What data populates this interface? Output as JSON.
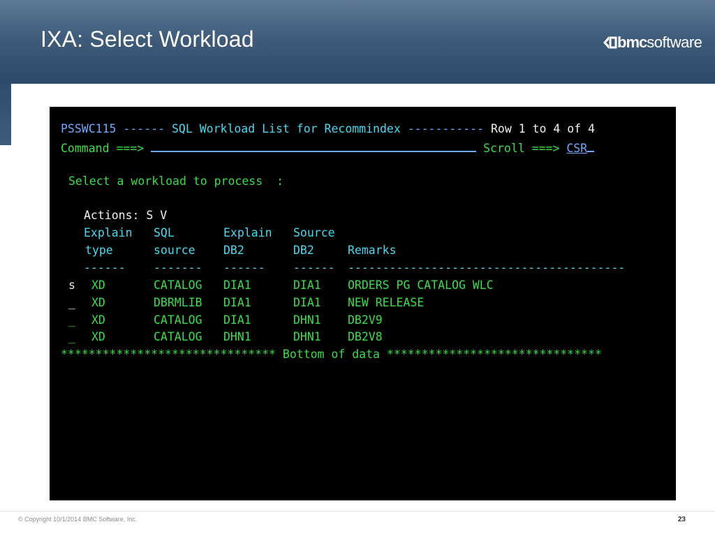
{
  "slide": {
    "title": "IXA: Select Workload",
    "logo_bold": "bmc",
    "logo_light": "software",
    "copyright": "© Copyright 10/1/2014 BMC Software, Inc.",
    "page_number": "23"
  },
  "terminal": {
    "panel_id": "PSSWC115",
    "title_dashes_left": "------",
    "title": "SQL Workload List for Recommindex",
    "title_dashes_right": "-----------",
    "row_info": "Row 1 to 4 of 4",
    "command_label": "Command ===>",
    "command_value": "",
    "scroll_label": "Scroll ===>",
    "scroll_value": "CSR",
    "prompt": "Select a workload to process  :",
    "actions_label": "Actions:",
    "actions_values": "S V",
    "columns": {
      "explain_type_1": "Explain",
      "explain_type_2": "type",
      "sql_source_1": "SQL",
      "sql_source_2": "source",
      "explain_db2_1": "Explain",
      "explain_db2_2": "DB2",
      "source_db2_1": "Source",
      "source_db2_2": "DB2",
      "remarks": "Remarks"
    },
    "separators": {
      "c1": "------",
      "c2": "-------",
      "c3": "------",
      "c4": "------",
      "c5": "----------------------------------------"
    },
    "rows": [
      {
        "sel": "s",
        "type": "XD",
        "source": "CATALOG",
        "explain_db2": "DIA1",
        "source_db2": "DIA1",
        "remarks": "ORDERS PG CATALOG WLC"
      },
      {
        "sel": "_",
        "type": "XD",
        "source": "DBRMLIB",
        "explain_db2": "DIA1",
        "source_db2": "DIA1",
        "remarks": "NEW RELEASE"
      },
      {
        "sel": "_",
        "type": "XD",
        "source": "CATALOG",
        "explain_db2": "DIA1",
        "source_db2": "DHN1",
        "remarks": "DB2V9"
      },
      {
        "sel": "_",
        "type": "XD",
        "source": "CATALOG",
        "explain_db2": "DHN1",
        "source_db2": "DHN1",
        "remarks": "DB2V8"
      }
    ],
    "bottom_left_stars": "*******************************",
    "bottom_text": "Bottom of data",
    "bottom_right_stars": "*******************************"
  }
}
